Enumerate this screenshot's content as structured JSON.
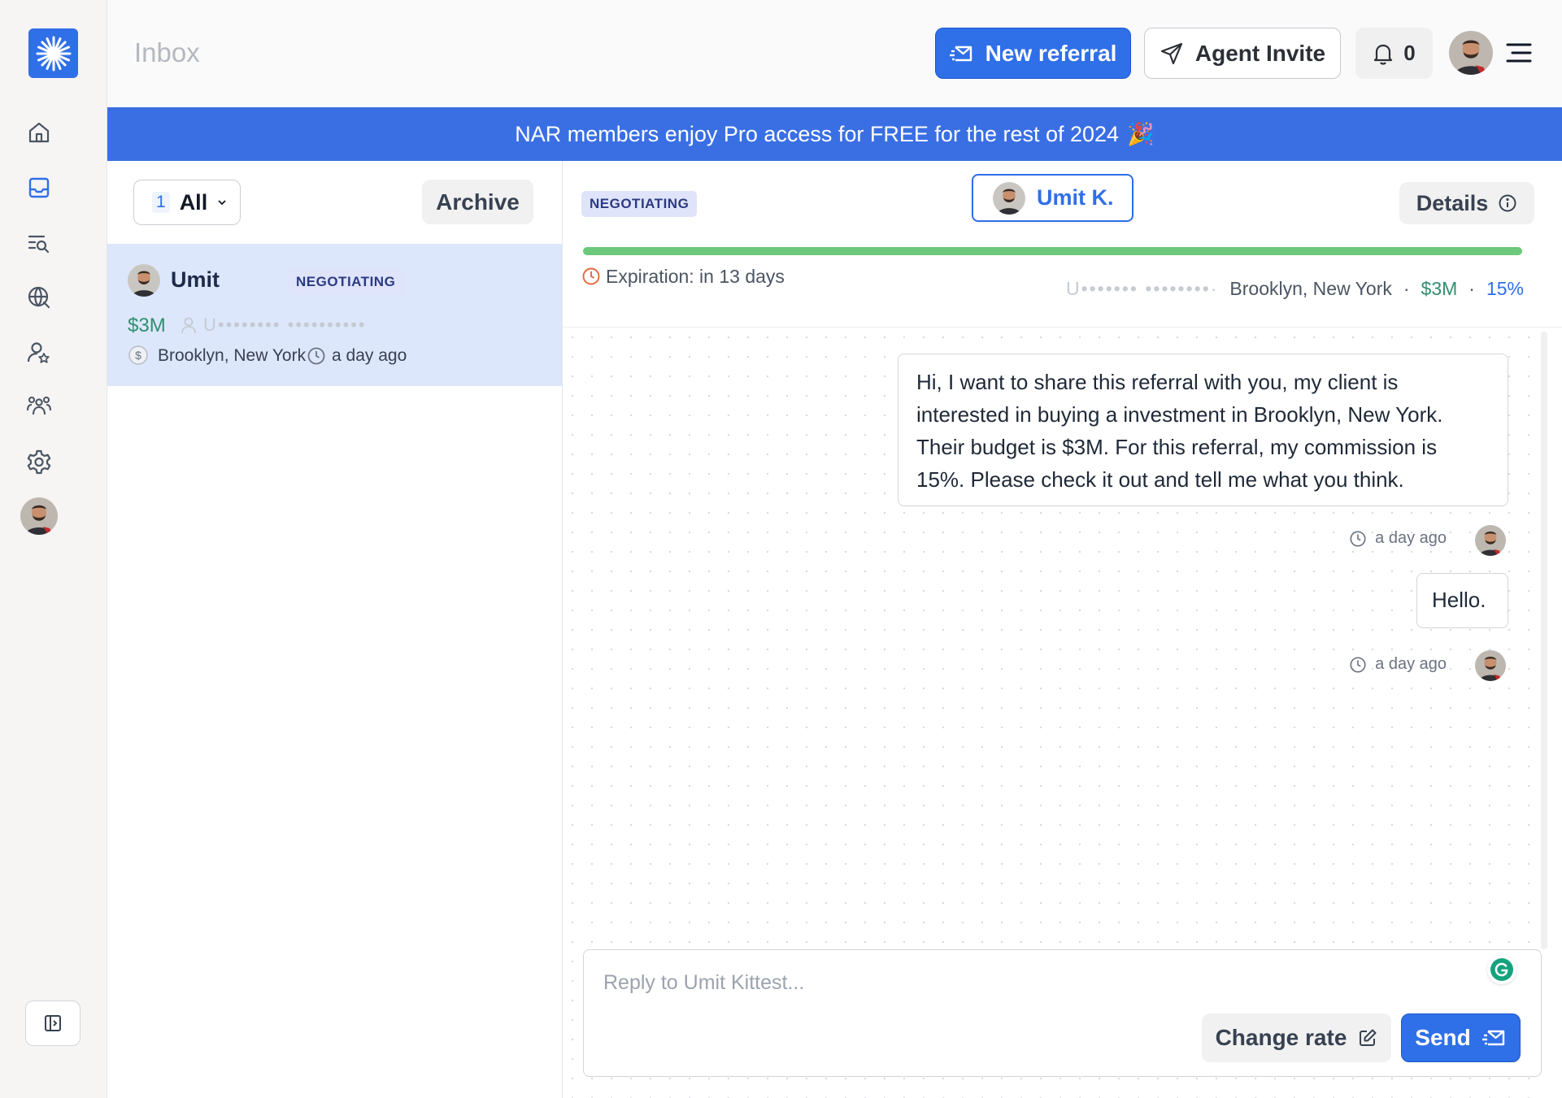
{
  "page": {
    "title": "Inbox"
  },
  "colors": {
    "accent": "#2f6fe8",
    "banner": "#3a6fe4",
    "selected_item": "#dde7fb",
    "price": "#2f8f6f",
    "progress": "#6cc87a"
  },
  "sidebar": {
    "items": [
      {
        "icon": "home-icon"
      },
      {
        "icon": "inbox-icon"
      },
      {
        "icon": "search-list-icon"
      },
      {
        "icon": "globe-icon"
      },
      {
        "icon": "user-star-icon"
      },
      {
        "icon": "team-icon"
      },
      {
        "icon": "settings-icon"
      }
    ]
  },
  "header": {
    "new_referral_label": "New referral",
    "agent_invite_label": "Agent Invite",
    "notification_count": "0"
  },
  "banner": {
    "text": "NAR members enjoy Pro access for FREE for the rest of 2024",
    "emoji": "🎉"
  },
  "list": {
    "filter_count": "1",
    "filter_label": "All",
    "archive_label": "Archive",
    "items": [
      {
        "name": "Umit",
        "status": "NEGOTIATING",
        "price": "$3M",
        "masked_user": "U•••••••• ••••••••••",
        "location": "Brooklyn, New York",
        "time": "a day ago"
      }
    ]
  },
  "conversation": {
    "status": "NEGOTIATING",
    "contact_name": "Umit K.",
    "details_label": "Details",
    "progress": 1.0,
    "expiration": "Expiration: in 13 days",
    "meta": {
      "masked_user": "U••••••• ••••••••·",
      "location": "Brooklyn, New York",
      "price": "$3M",
      "rate": "15%"
    },
    "messages": [
      {
        "text": "Hi, I want to share this referral with you, my client is interested in buying a investment in Brooklyn, New York. Their budget is $3M. For this referral, my commission is 15%. Please check it out and tell me what you think.",
        "time": "a day ago"
      },
      {
        "text": "Hello.",
        "time": "a day ago"
      }
    ],
    "composer": {
      "placeholder": "Reply to Umit Kittest...",
      "change_rate_label": "Change rate",
      "send_label": "Send"
    }
  }
}
